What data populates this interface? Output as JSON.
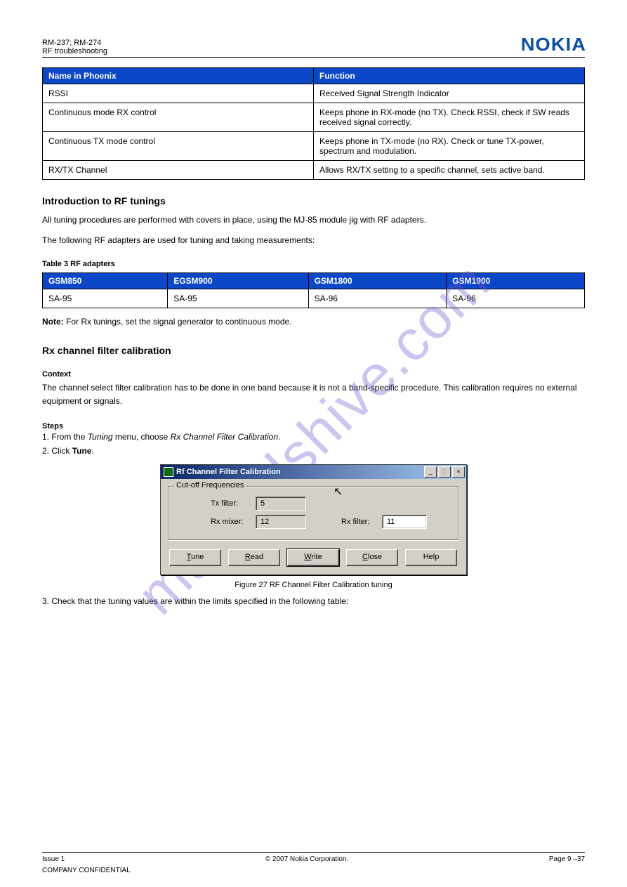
{
  "build_banner": "",
  "watermark": "manualshive.com",
  "header": {
    "left": "RM-237; RM-274",
    "right_top": "RF troubleshooting",
    "logo": "NOKIA"
  },
  "table1": {
    "headers": [
      "Name in Phoenix",
      "Function"
    ],
    "rows": [
      [
        "RSSI",
        "Received Signal Strength Indicator"
      ],
      [
        "Continuous mode RX control",
        "Keeps phone in RX-mode (no TX). Check RSSI, check if SW reads received signal correctly."
      ],
      [
        "Continuous TX mode control",
        "Keeps phone in TX-mode (no RX). Check or tune TX-power, spectrum and modulation."
      ],
      [
        "RX/TX Channel",
        "Allows RX/TX setting to a specific channel, sets active band."
      ]
    ]
  },
  "section_intro_h": "Introduction to RF tunings",
  "section_intro_p1": "All tuning procedures are performed with covers in place, using the MJ-85 module jig with RF adapters.",
  "section_intro_p2": "The following RF adapters are used for tuning and taking measurements:",
  "table2_caption": "Table 3 RF adapters",
  "table2": {
    "headers": [
      "GSM850",
      "EGSM900",
      "GSM1800",
      "GSM1900"
    ],
    "rows": [
      [
        "SA-95",
        "SA-95",
        "SA-96",
        "SA-96"
      ]
    ]
  },
  "note": {
    "label": "Note: ",
    "text": "For Rx tunings, set the signal generator to continuous mode."
  },
  "rx_h": "Rx channel filter calibration",
  "context_h": "Context",
  "context_p": "The channel select filter calibration has to be done in one band because it is not a band-specific procedure. This calibration requires no external equipment or signals.",
  "steps_h": "Steps",
  "step1": {
    "num": "1.",
    "text": "From the ",
    "em": "Tuning",
    "text2": " menu, choose ",
    "em2": "Rx Channel Filter Calibration",
    "text3": "."
  },
  "step2": {
    "num": "2.",
    "text": "Click ",
    "strong": "Tune",
    "text2": "."
  },
  "dialog": {
    "title": "Rf Channel Filter Calibration",
    "group": "Cut-off Frequencies",
    "tx_filter_label": "Tx filter:",
    "tx_filter_value": "5",
    "rx_mixer_label": "Rx mixer:",
    "rx_mixer_value": "12",
    "rx_filter_label": "Rx filter:",
    "rx_filter_value": "11",
    "buttons": {
      "tune": "Tune",
      "read": "Read",
      "write": "Write",
      "close": "Close",
      "help": "Help"
    },
    "sys": {
      "min": "_",
      "max": "□",
      "close": "×"
    }
  },
  "figure_caption": "Figure 27 RF Channel Filter Calibration tuning",
  "step3": {
    "num": "3.",
    "text": "Check that the tuning values are within the limits specified in the following table:"
  },
  "footer": {
    "left_top": "Issue 1",
    "left_bottom": "COMPANY CONFIDENTIAL",
    "center_top": "© 2007 Nokia Corporation.",
    "center_bottom": "",
    "right_top": "Page 9 –37",
    "right_bottom": ""
  }
}
